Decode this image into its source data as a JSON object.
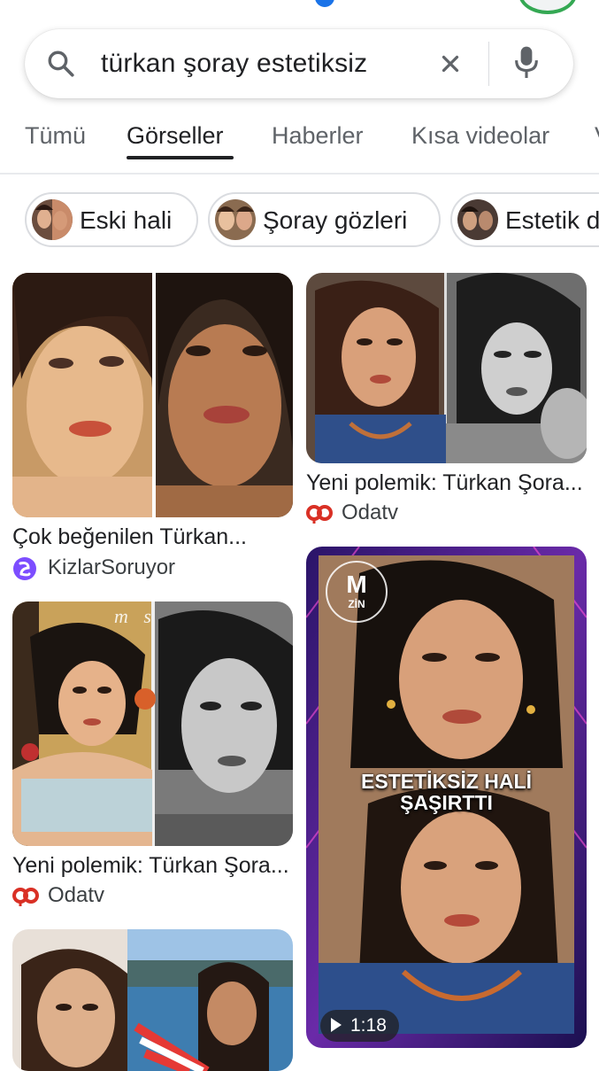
{
  "search": {
    "query": "türkan şoray estetiksiz"
  },
  "tabs": [
    {
      "label": "Tümü"
    },
    {
      "label": "Görseller"
    },
    {
      "label": "Haberler"
    },
    {
      "label": "Kısa videolar"
    },
    {
      "label": "V"
    }
  ],
  "active_tab": "Görseller",
  "chips": [
    {
      "label": "Eski hali"
    },
    {
      "label": "Şoray gözleri"
    },
    {
      "label": "Estetik d"
    }
  ],
  "results": [
    {
      "title": "Çok beğenilen Türkan...",
      "source": "KizlarSoruyor",
      "source_icon": "kizlarsoruyor-logo"
    },
    {
      "title": "Yeni polemik: Türkan Şora...",
      "source": "Odatv",
      "source_icon": "odatv-logo"
    },
    {
      "title": "Yeni polemik: Türkan Şora...",
      "source": "Odatv",
      "source_icon": "odatv-logo",
      "watermark": "m s"
    },
    {
      "overlay_line1": "ESTETİKSİZ HALİ",
      "overlay_line2": "ŞAŞIRTTI",
      "logo_m": "M",
      "logo_zin": "ZİN",
      "duration": "1:18",
      "is_video": true
    }
  ],
  "colors": {
    "accent_blue": "#1a73e8",
    "active_tab": "#202124",
    "inactive_tab": "#5f6368",
    "odatv_red": "#d93025",
    "kizlarsoruyor_purple": "#7c4dff",
    "video_frame": "#3b1f8a"
  }
}
